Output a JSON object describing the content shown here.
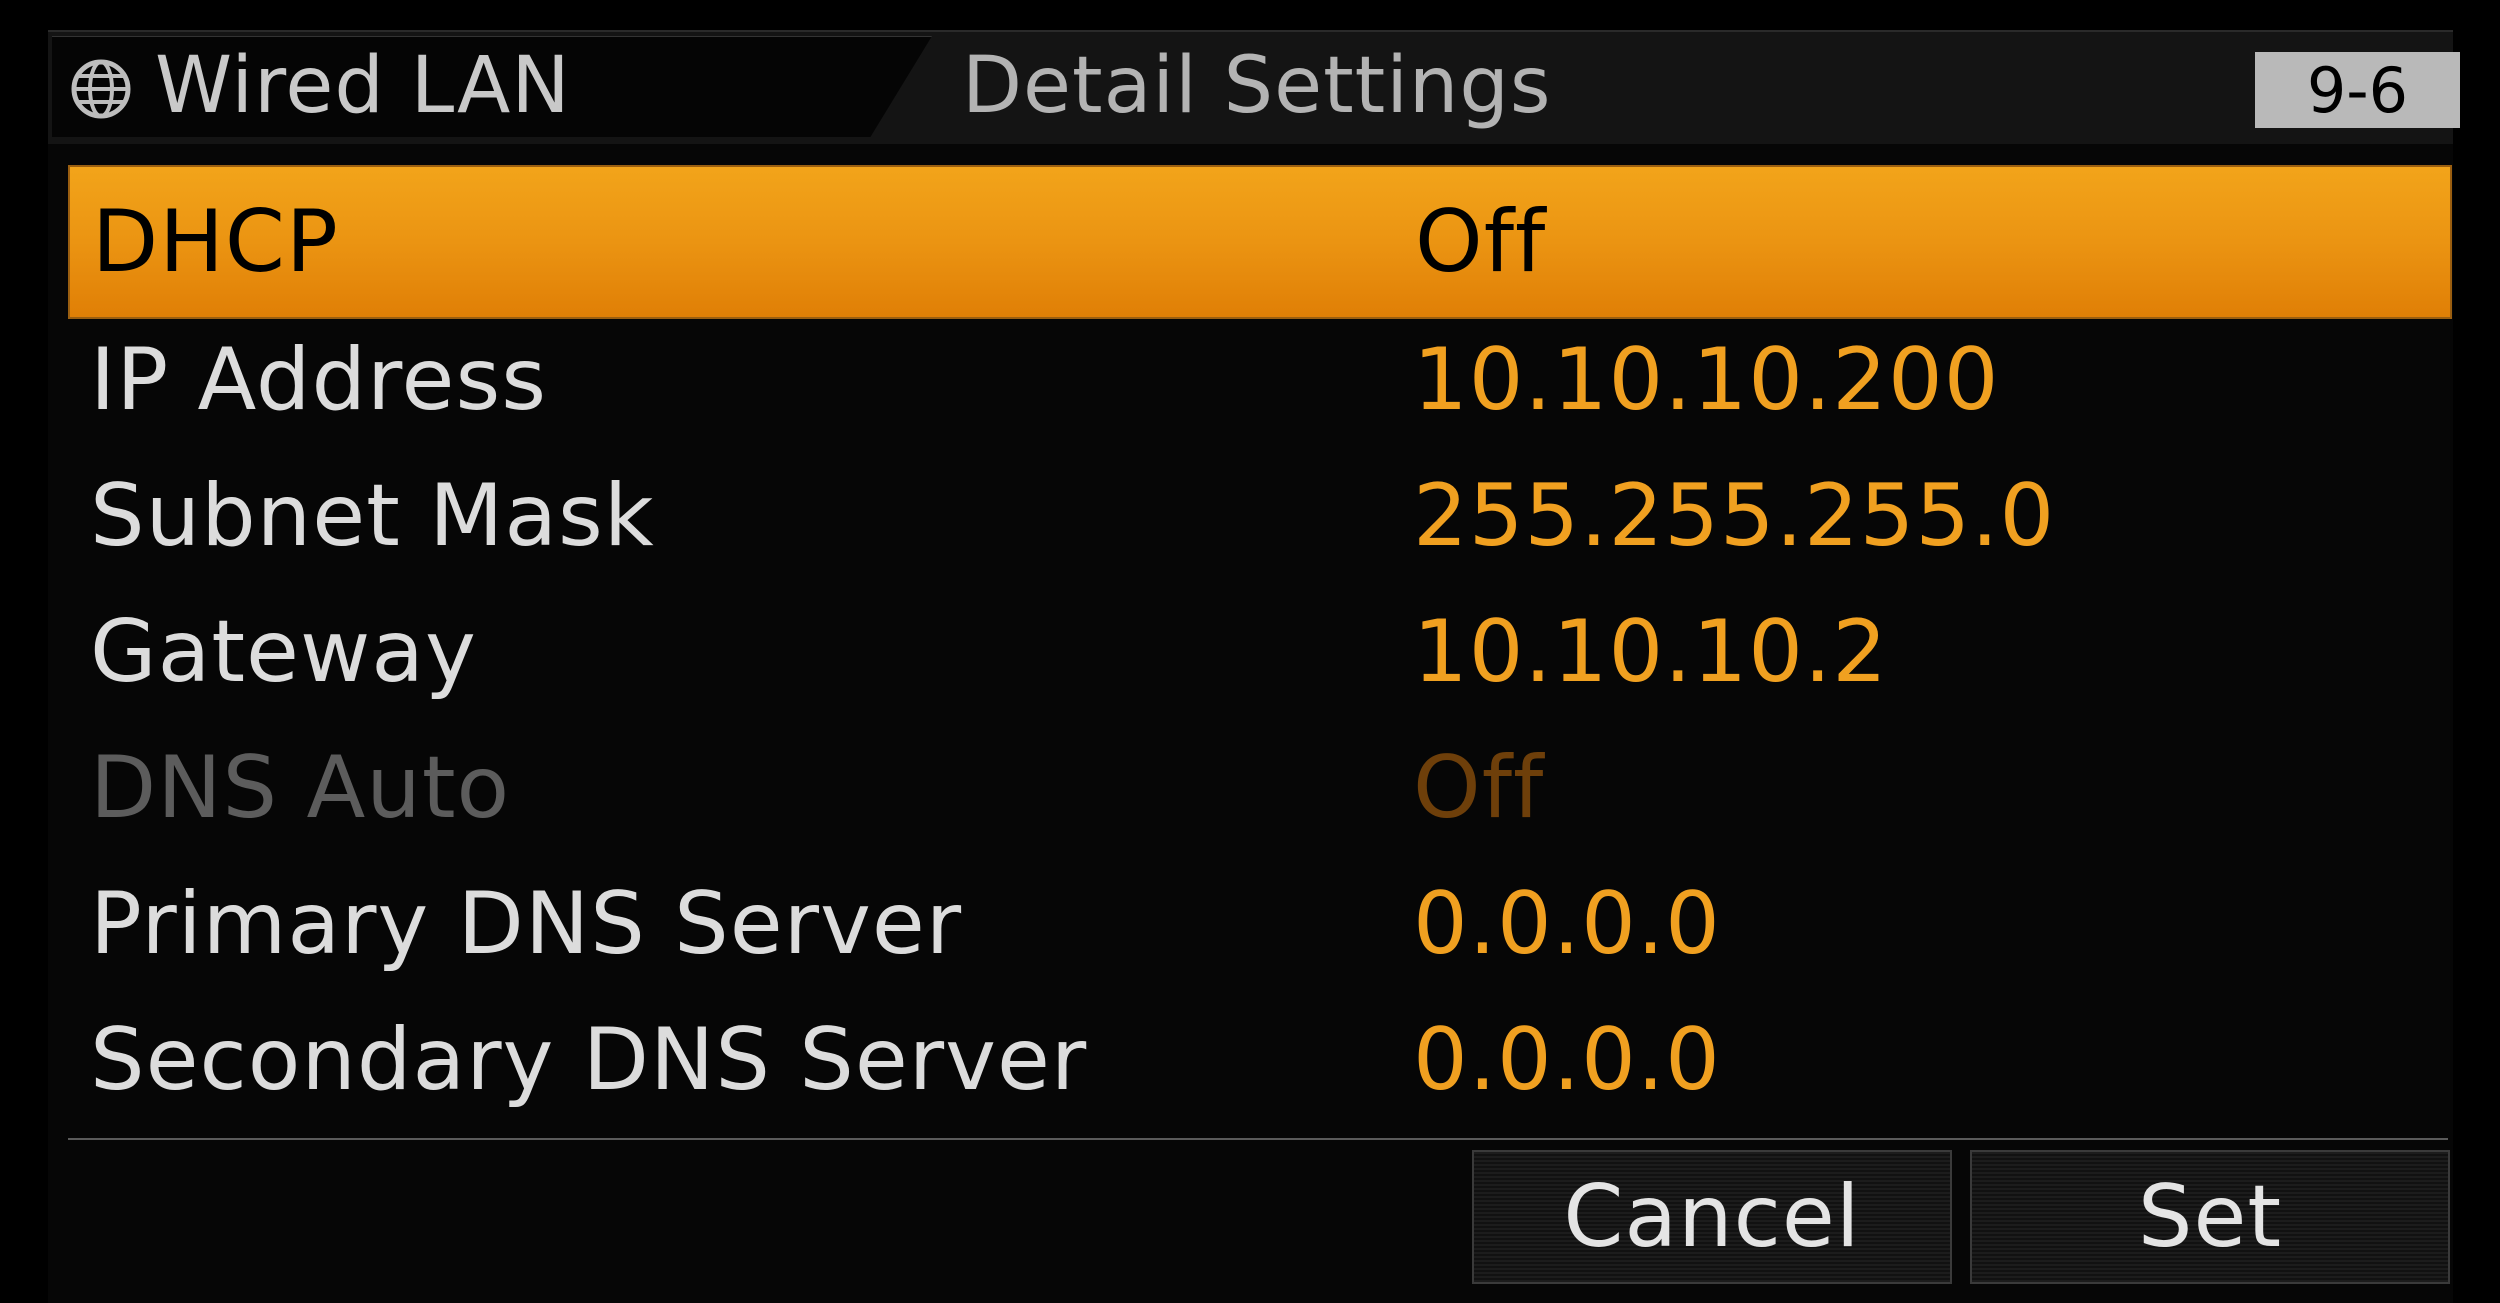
{
  "header": {
    "tab_title": "Wired LAN",
    "detail_title": "Detail Settings",
    "page_number": "9-6",
    "icon": "globe-icon"
  },
  "settings": [
    {
      "label": "DHCP",
      "value": "Off",
      "state": "selected"
    },
    {
      "label": "IP Address",
      "value": "10.10.10.200",
      "state": "normal"
    },
    {
      "label": "Subnet Mask",
      "value": "255.255.255.0",
      "state": "normal"
    },
    {
      "label": "Gateway",
      "value": "10.10.10.2",
      "state": "normal"
    },
    {
      "label": "DNS Auto",
      "value": "Off",
      "state": "disabled"
    },
    {
      "label": "Primary DNS Server",
      "value": "0.0.0.0",
      "state": "normal"
    },
    {
      "label": "Secondary DNS Server",
      "value": "0.0.0.0",
      "state": "normal"
    }
  ],
  "buttons": {
    "cancel_label": "Cancel",
    "set_label": "Set"
  },
  "colors": {
    "accent": "#f0a020",
    "selected_bg": "#eb9412",
    "disabled_label": "#5c5c5c",
    "disabled_value": "#6e3f0a"
  }
}
